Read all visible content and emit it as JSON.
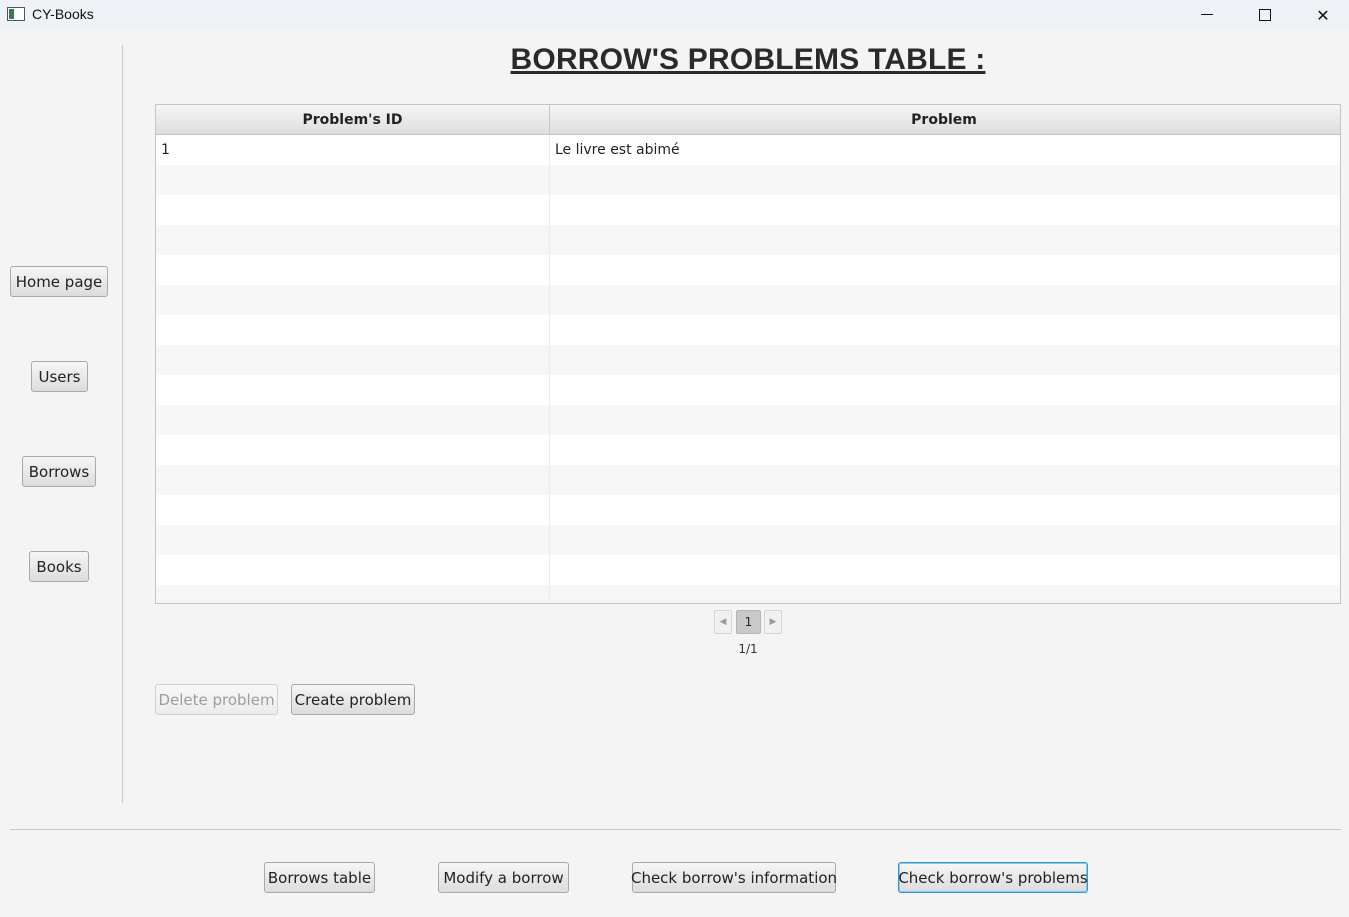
{
  "window": {
    "title": "CY-Books",
    "controls": [
      "minimize-icon",
      "maximize-icon",
      "close-icon"
    ]
  },
  "sidebar": {
    "items": [
      {
        "label": "Home page"
      },
      {
        "label": "Users"
      },
      {
        "label": "Borrows"
      },
      {
        "label": "Books"
      }
    ]
  },
  "main": {
    "title": "BORROW'S PROBLEMS TABLE :",
    "table": {
      "columns": [
        "Problem's ID",
        "Problem"
      ],
      "rows": [
        [
          "1",
          "Le livre est abimé"
        ]
      ]
    },
    "pagination": {
      "current_page": "1",
      "page_label": "1/1"
    },
    "actions": {
      "delete_label": "Delete problem",
      "create_label": "Create problem"
    }
  },
  "bottom_nav": {
    "items": [
      {
        "label": "Borrows table"
      },
      {
        "label": "Modify a borrow"
      },
      {
        "label": "Check borrow's information"
      },
      {
        "label": "Check borrow's problems"
      }
    ]
  },
  "colors": {
    "focus_border": "#2d9ad6",
    "background": "#f4f4f4"
  }
}
